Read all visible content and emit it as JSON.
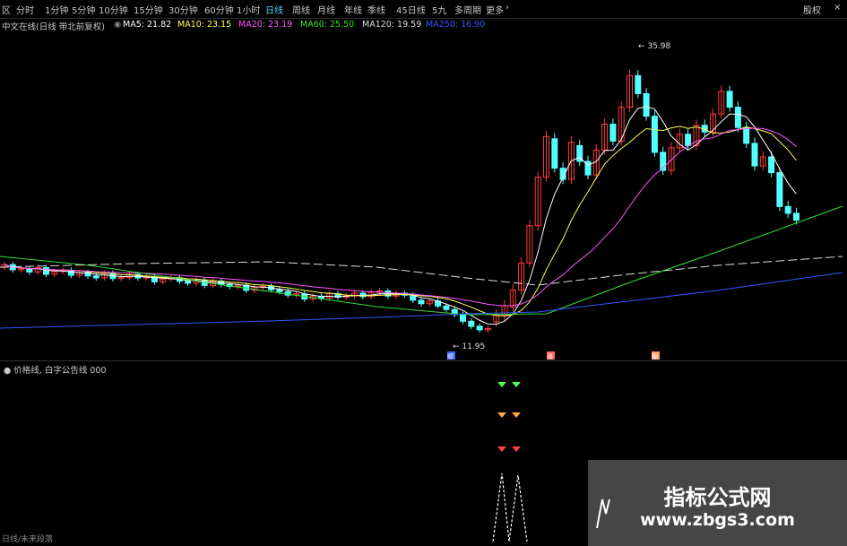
{
  "toolbar": {
    "tabs": [
      "区",
      "分时",
      "1分钟",
      "5分钟",
      "10分钟",
      "15分钟",
      "30分钟",
      "60分钟",
      "1小时",
      "日线",
      "周线",
      "月线",
      "年线",
      "季线",
      "45日线",
      "5九",
      "多周期",
      "更多"
    ],
    "active_tab": "日线",
    "more_arrow": "›",
    "right_label": "股权",
    "close": "×"
  },
  "info": {
    "title": "中文在线(日线 带北前复权)",
    "ma5": "MA5: 21.82",
    "ma10": "MA10: 23.15",
    "ma20": "MA20: 23.19",
    "ma60": "MA60: 25.50",
    "ma120": "MA120: 19.59",
    "ma250": "MA250: 16.90"
  },
  "colors": {
    "up": "#ff3a3a",
    "down": "#54ffff",
    "ma5": "#ffffff",
    "ma10": "#ffff55",
    "ma20": "#ff55ff",
    "ma60": "#33dd33",
    "ma120": "#dddddd",
    "ma250": "#3355ff"
  },
  "chart": {
    "high_label": "35.98",
    "low_label": "11.95",
    "markers": [
      "顺",
      "涨",
      "翻"
    ]
  },
  "sub": {
    "label": "● 价格线, 白字公告线 000"
  },
  "bottom": {
    "text": "日线/未来段落"
  },
  "watermark": {
    "line1": "指标公式网",
    "line2": "www.zbgs3.com"
  }
}
